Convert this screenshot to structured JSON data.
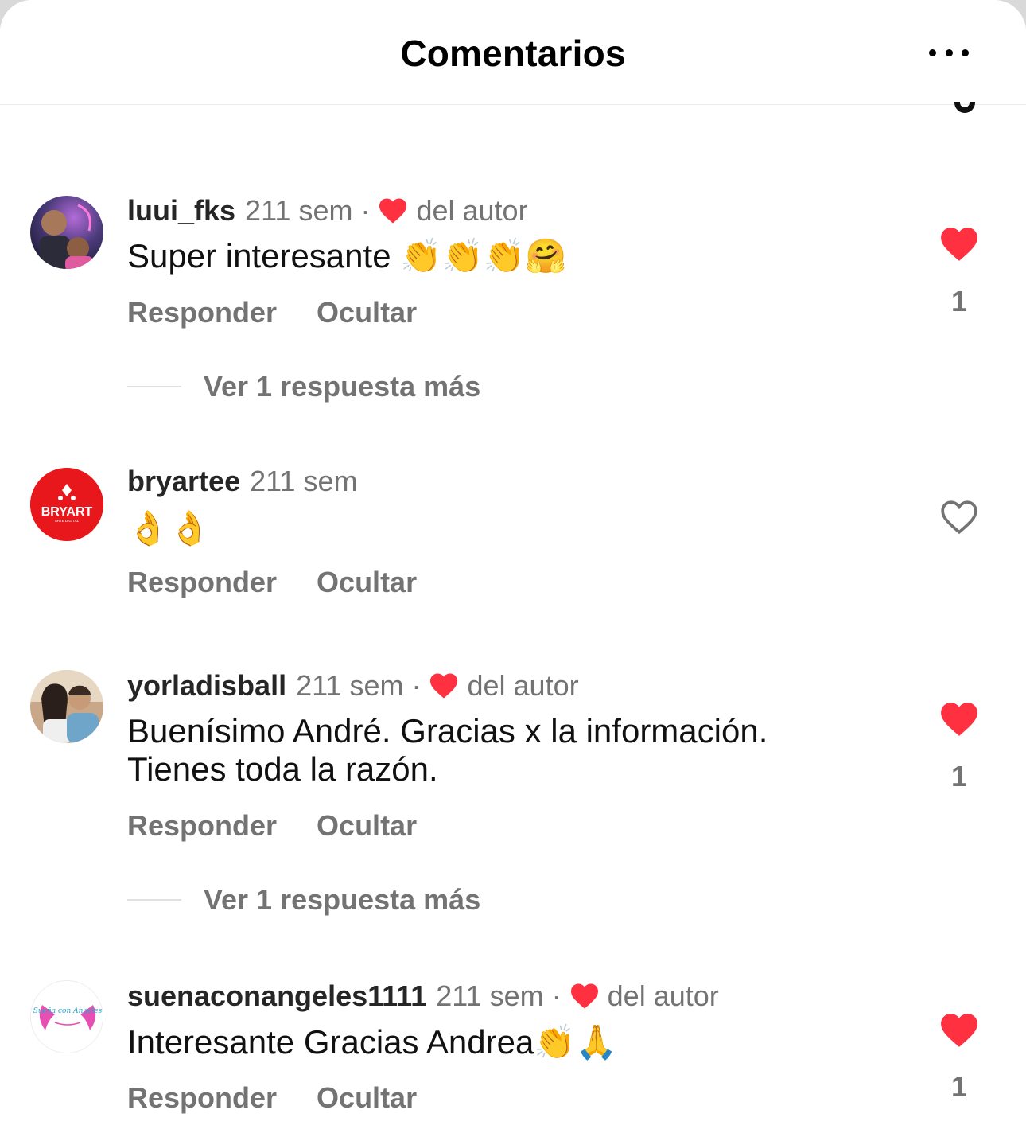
{
  "header": {
    "title": "Comentarios",
    "more_icon": "more-horizontal-icon"
  },
  "comments": [
    {
      "username": "luui_fks",
      "time": "211 sem",
      "dot": "·",
      "author_label": "del autor",
      "text": "Super interesante 👏👏👏🤗",
      "reply": "Responder",
      "hide": "Ocultar",
      "liked": true,
      "likes": "1",
      "view_replies": "Ver 1 respuesta más"
    },
    {
      "username": "bryartee",
      "time": "211 sem",
      "text": "👌👌",
      "reply": "Responder",
      "hide": "Ocultar",
      "liked": false,
      "avatar_text": "BRYART",
      "avatar_subtext": "ARTE DIGITAL"
    },
    {
      "username": "yorladisball",
      "time": "211 sem",
      "dot": "·",
      "author_label": "del autor",
      "text_line1": "Buenísimo André. Gracias x la información.",
      "text_line2": "Tienes toda la razón.",
      "reply": "Responder",
      "hide": "Ocultar",
      "liked": true,
      "likes": "1",
      "view_replies": "Ver 1 respuesta más"
    },
    {
      "username": "suenaconangeles1111",
      "time": "211 sem",
      "dot": "·",
      "author_label": "del autor",
      "text": "Interesante Gracias Andrea👏🙏",
      "reply": "Responder",
      "hide": "Ocultar",
      "liked": true,
      "likes": "1",
      "avatar_text": "Sueña con Angeles"
    }
  ],
  "colors": {
    "heart_red": "#ff3040",
    "secondary_text": "#737373",
    "bryart_red": "#e8171c"
  }
}
